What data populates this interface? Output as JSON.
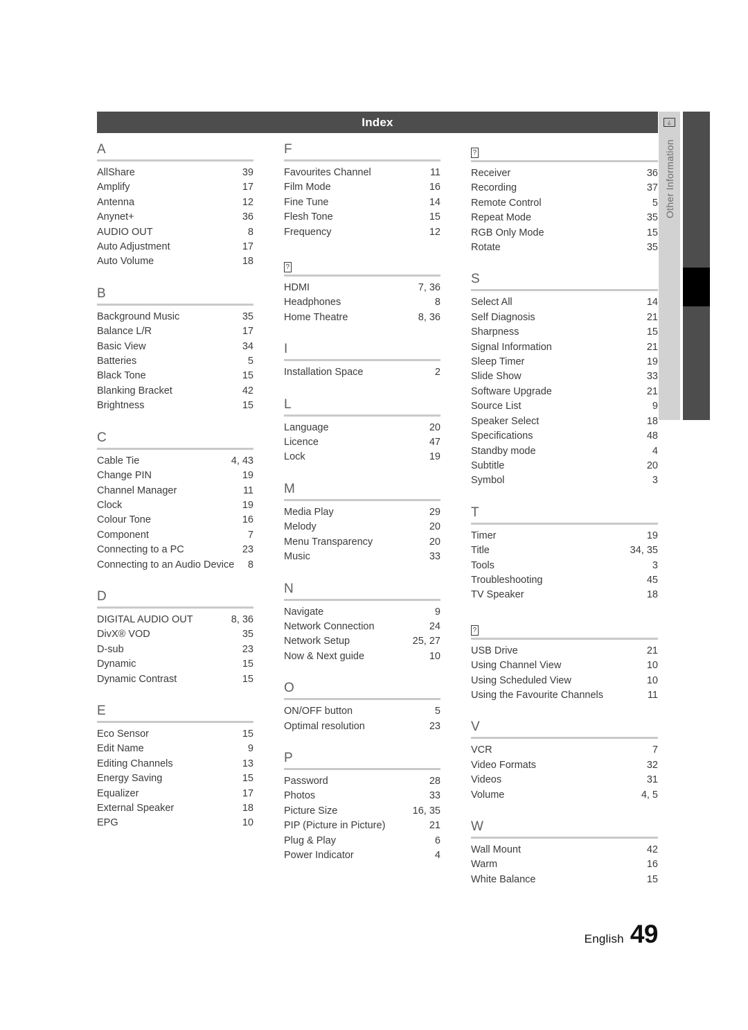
{
  "header": {
    "title": "Index"
  },
  "side_tab": {
    "icon": "tofu-missing-glyph-icon",
    "icon_char": "?",
    "label": "Other Information"
  },
  "colors": {
    "header_bar": "#4d4d4d",
    "side_tab": "#d2d2d2",
    "side_rail": "#4d4d4d",
    "side_rail_active": "#000000",
    "rule": "#c9c9c9",
    "text": "#3b3b3b",
    "letter": "#5f5f5f"
  },
  "columns": [
    {
      "sections": [
        {
          "letter": "A",
          "is_tofu": false,
          "entries": [
            {
              "name": "AllShare",
              "page": "39"
            },
            {
              "name": "Amplify",
              "page": "17"
            },
            {
              "name": "Antenna",
              "page": "12"
            },
            {
              "name": "Anynet+",
              "page": "36"
            },
            {
              "name": "AUDIO OUT",
              "page": "8"
            },
            {
              "name": "Auto Adjustment",
              "page": "17"
            },
            {
              "name": "Auto Volume",
              "page": "18"
            }
          ]
        },
        {
          "letter": "B",
          "is_tofu": false,
          "entries": [
            {
              "name": "Background Music",
              "page": "35"
            },
            {
              "name": "Balance L/R",
              "page": "17"
            },
            {
              "name": "Basic View",
              "page": "34"
            },
            {
              "name": "Batteries",
              "page": "5"
            },
            {
              "name": "Black Tone",
              "page": "15"
            },
            {
              "name": "Blanking Bracket",
              "page": "42"
            },
            {
              "name": "Brightness",
              "page": "15"
            }
          ]
        },
        {
          "letter": "C",
          "is_tofu": false,
          "entries": [
            {
              "name": "Cable Tie",
              "page": "4, 43"
            },
            {
              "name": "Change PIN",
              "page": "19"
            },
            {
              "name": "Channel Manager",
              "page": "11"
            },
            {
              "name": "Clock",
              "page": "19"
            },
            {
              "name": "Colour Tone",
              "page": "16"
            },
            {
              "name": "Component",
              "page": "7"
            },
            {
              "name": "Connecting to a PC",
              "page": "23"
            },
            {
              "name": "Connecting to an Audio Device",
              "page": "8"
            }
          ]
        },
        {
          "letter": "D",
          "is_tofu": false,
          "entries": [
            {
              "name": "DIGITAL AUDIO OUT",
              "page": "8, 36"
            },
            {
              "name": "DivX® VOD",
              "page": "35"
            },
            {
              "name": "D-sub",
              "page": "23"
            },
            {
              "name": "Dynamic",
              "page": "15"
            },
            {
              "name": "Dynamic Contrast",
              "page": "15"
            }
          ]
        },
        {
          "letter": "E",
          "is_tofu": false,
          "entries": [
            {
              "name": "Eco Sensor",
              "page": "15"
            },
            {
              "name": "Edit Name",
              "page": "9"
            },
            {
              "name": "Editing Channels",
              "page": "13"
            },
            {
              "name": "Energy Saving",
              "page": "15"
            },
            {
              "name": "Equalizer",
              "page": "17"
            },
            {
              "name": "External Speaker",
              "page": "18"
            },
            {
              "name": "EPG",
              "page": "10"
            }
          ]
        }
      ]
    },
    {
      "sections": [
        {
          "letter": "F",
          "is_tofu": false,
          "entries": [
            {
              "name": "Favourites Channel",
              "page": "11"
            },
            {
              "name": "Film Mode",
              "page": "16"
            },
            {
              "name": "Fine Tune",
              "page": "14"
            },
            {
              "name": "Flesh Tone",
              "page": "15"
            },
            {
              "name": "Frequency",
              "page": "12"
            }
          ]
        },
        {
          "letter": "?",
          "is_tofu": true,
          "entries": [
            {
              "name": "HDMI",
              "page": "7, 36"
            },
            {
              "name": "Headphones",
              "page": "8"
            },
            {
              "name": "Home Theatre",
              "page": "8, 36"
            }
          ]
        },
        {
          "letter": "I",
          "is_tofu": false,
          "entries": [
            {
              "name": "Installation Space",
              "page": "2"
            }
          ]
        },
        {
          "letter": "L",
          "is_tofu": false,
          "entries": [
            {
              "name": "Language",
              "page": "20"
            },
            {
              "name": "Licence",
              "page": "47"
            },
            {
              "name": "Lock",
              "page": "19"
            }
          ]
        },
        {
          "letter": "M",
          "is_tofu": false,
          "entries": [
            {
              "name": "Media Play",
              "page": "29"
            },
            {
              "name": "Melody",
              "page": "20"
            },
            {
              "name": "Menu Transparency",
              "page": "20"
            },
            {
              "name": "Music",
              "page": "33"
            }
          ]
        },
        {
          "letter": "N",
          "is_tofu": false,
          "entries": [
            {
              "name": "Navigate",
              "page": "9"
            },
            {
              "name": "Network Connection",
              "page": "24"
            },
            {
              "name": "Network Setup",
              "page": "25, 27"
            },
            {
              "name": "Now & Next guide",
              "page": "10"
            }
          ]
        },
        {
          "letter": "O",
          "is_tofu": false,
          "entries": [
            {
              "name": "ON/OFF button",
              "page": "5"
            },
            {
              "name": "Optimal resolution",
              "page": "23"
            }
          ]
        },
        {
          "letter": "P",
          "is_tofu": false,
          "entries": [
            {
              "name": "Password",
              "page": "28"
            },
            {
              "name": "Photos",
              "page": "33"
            },
            {
              "name": "Picture Size",
              "page": "16, 35"
            },
            {
              "name": "PIP (Picture in Picture)",
              "page": "21"
            },
            {
              "name": "Plug & Play",
              "page": "6"
            },
            {
              "name": "Power Indicator",
              "page": "4"
            }
          ]
        }
      ]
    },
    {
      "sections": [
        {
          "letter": "?",
          "is_tofu": true,
          "entries": [
            {
              "name": "Receiver",
              "page": "36"
            },
            {
              "name": "Recording",
              "page": "37"
            },
            {
              "name": "Remote Control",
              "page": "5"
            },
            {
              "name": "Repeat Mode",
              "page": "35"
            },
            {
              "name": "RGB Only Mode",
              "page": "15"
            },
            {
              "name": "Rotate",
              "page": "35"
            }
          ]
        },
        {
          "letter": "S",
          "is_tofu": false,
          "entries": [
            {
              "name": "Select All",
              "page": "14"
            },
            {
              "name": "Self Diagnosis",
              "page": "21"
            },
            {
              "name": "Sharpness",
              "page": "15"
            },
            {
              "name": "Signal Information",
              "page": "21"
            },
            {
              "name": "Sleep Timer",
              "page": "19"
            },
            {
              "name": "Slide Show",
              "page": "33"
            },
            {
              "name": "Software Upgrade",
              "page": "21"
            },
            {
              "name": "Source List",
              "page": "9"
            },
            {
              "name": "Speaker Select",
              "page": "18"
            },
            {
              "name": "Specifications",
              "page": "48"
            },
            {
              "name": "Standby mode",
              "page": "4"
            },
            {
              "name": "Subtitle",
              "page": "20"
            },
            {
              "name": "Symbol",
              "page": "3"
            }
          ]
        },
        {
          "letter": "T",
          "is_tofu": false,
          "entries": [
            {
              "name": "Timer",
              "page": "19"
            },
            {
              "name": "Title",
              "page": "34, 35"
            },
            {
              "name": "Tools",
              "page": "3"
            },
            {
              "name": "Troubleshooting",
              "page": "45"
            },
            {
              "name": "TV Speaker",
              "page": "18"
            }
          ]
        },
        {
          "letter": "?",
          "is_tofu": true,
          "entries": [
            {
              "name": "USB Drive",
              "page": "21"
            },
            {
              "name": "Using Channel View",
              "page": "10"
            },
            {
              "name": "Using Scheduled View",
              "page": "10"
            },
            {
              "name": "Using the Favourite Channels",
              "page": "11"
            }
          ]
        },
        {
          "letter": "V",
          "is_tofu": false,
          "entries": [
            {
              "name": "VCR",
              "page": "7"
            },
            {
              "name": "Video Formats",
              "page": "32"
            },
            {
              "name": "Videos",
              "page": "31"
            },
            {
              "name": "Volume",
              "page": "4, 5"
            }
          ]
        },
        {
          "letter": "W",
          "is_tofu": false,
          "entries": [
            {
              "name": "Wall Mount",
              "page": "42"
            },
            {
              "name": "Warm",
              "page": "16"
            },
            {
              "name": "White Balance",
              "page": "15"
            }
          ]
        }
      ]
    }
  ],
  "footer": {
    "language": "English",
    "page_number": "49"
  }
}
